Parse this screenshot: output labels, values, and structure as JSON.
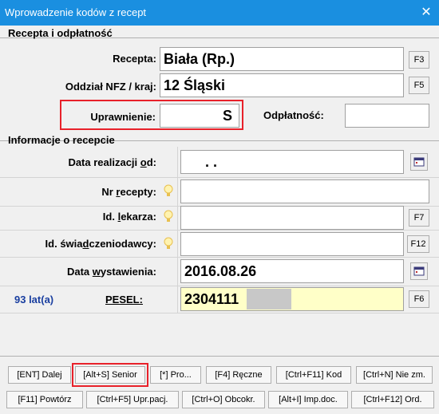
{
  "window": {
    "title": "Wprowadzenie kodów z recept",
    "close_symbol": "✕"
  },
  "section1": {
    "title": "Recepta i odpłatność",
    "recepta_label": "Recepta:",
    "recepta_value": "Biała (Rp.)",
    "recepta_key": "F3",
    "oddzial_label": "Oddział NFZ / kraj:",
    "oddzial_value": "12 Śląski",
    "oddzial_key": "F5",
    "uprawnienie_label": "Uprawnienie:",
    "uprawnienie_value": "S",
    "odplatnosc_label": "Odpłatność:",
    "odplatnosc_value": ""
  },
  "section2": {
    "title": "Informacje o recepcie",
    "data_realizacji_label_pre": "Data realizacji ",
    "data_realizacji_label_u": "o",
    "data_realizacji_label_post": "d:",
    "data_realizacji_value": ". .",
    "nr_recepty_label_pre": "Nr ",
    "nr_recepty_label_u": "r",
    "nr_recepty_label_post": "ecepty:",
    "nr_recepty_value": "",
    "id_lekarza_label_pre": "Id. ",
    "id_lekarza_label_u": "l",
    "id_lekarza_label_post": "ekarza:",
    "id_lekarza_value": "",
    "id_lekarza_key": "F7",
    "id_swiadcz_label_pre": "Id. świa",
    "id_swiadcz_label_u": "d",
    "id_swiadcz_label_post": "czeniodawcy:",
    "id_swiadcz_value": "",
    "id_swiadcz_key": "F12",
    "data_wyst_label_pre": "Data ",
    "data_wyst_label_u": "w",
    "data_wyst_label_post": "ystawienia:",
    "data_wyst_value": "2016.08.26",
    "age_text": "93 lat(a)",
    "pesel_label": "PESEL:",
    "pesel_value": "2304111",
    "pesel_key": "F6"
  },
  "buttons_row1": [
    "[ENT] Dalej",
    "[Alt+S] Senior",
    "[*] Pro...",
    "[F4] Ręczne",
    "[Ctrl+F11] Kod",
    "[Ctrl+N] Nie zm."
  ],
  "buttons_row2": [
    "[F11] Powtórz",
    "[Ctrl+F5] Upr.pacj.",
    "[Ctrl+O] Obcokr.",
    "[Alt+I] Imp.doc.",
    "[Ctrl+F12] Ord."
  ],
  "colors": {
    "titlebar": "#1a8fe0",
    "highlight": "#e8212a",
    "pesel_bg": "#ffffc8",
    "age_text": "#1a3fa0"
  }
}
